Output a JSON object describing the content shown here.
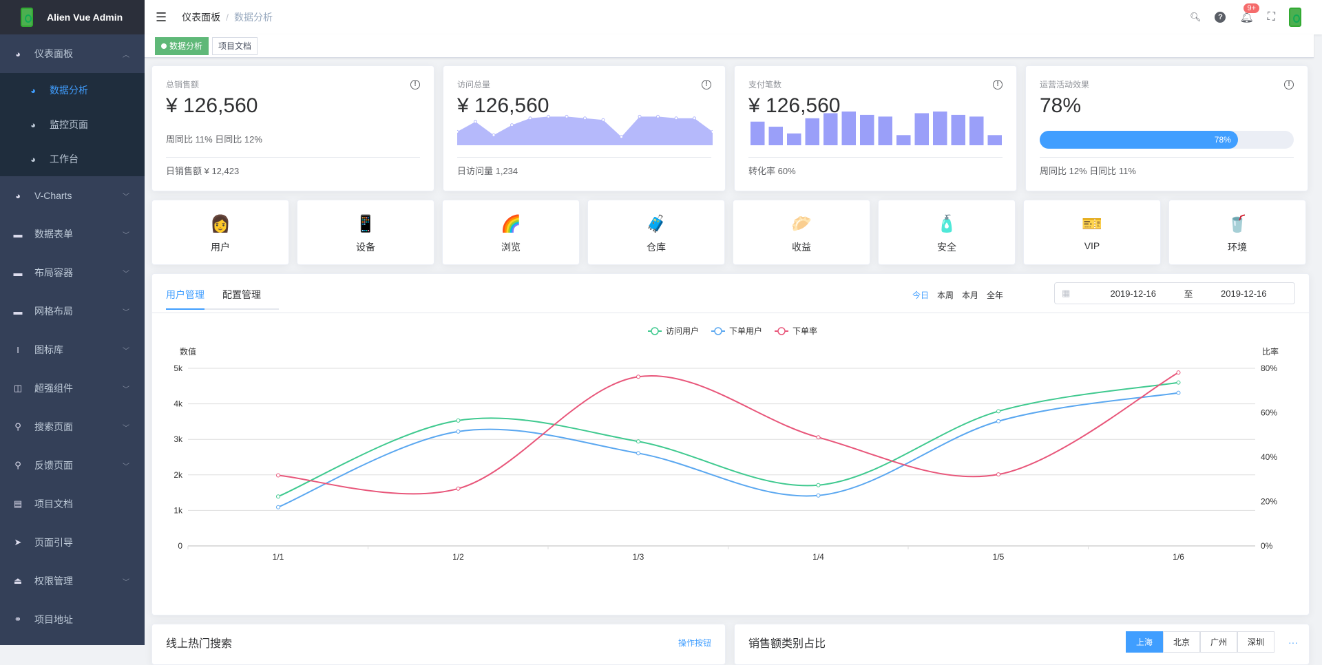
{
  "app": {
    "title": "Alien Vue Admin"
  },
  "sidebar": {
    "items": [
      {
        "label": "仪表面板",
        "icon": "dashboard-icon",
        "open": true,
        "children": [
          {
            "label": "数据分析",
            "active": true
          },
          {
            "label": "监控页面"
          },
          {
            "label": "工作台"
          }
        ]
      },
      {
        "label": "V-Charts",
        "icon": "dashboard-icon",
        "arrow": true
      },
      {
        "label": "数据表单",
        "icon": "folder-icon",
        "arrow": true
      },
      {
        "label": "布局容器",
        "icon": "folder-icon",
        "arrow": true
      },
      {
        "label": "网格布局",
        "icon": "folder-icon",
        "arrow": true
      },
      {
        "label": "图标库",
        "icon": "font-icon",
        "arrow": true
      },
      {
        "label": "超强组件",
        "icon": "chart-icon",
        "arrow": true
      },
      {
        "label": "搜索页面",
        "icon": "search-icon",
        "arrow": true
      },
      {
        "label": "反馈页面",
        "icon": "search-icon",
        "arrow": true
      },
      {
        "label": "项目文档",
        "icon": "document-icon",
        "arrow": false
      },
      {
        "label": "页面引导",
        "icon": "send-icon",
        "arrow": false
      },
      {
        "label": "权限管理",
        "icon": "lock-icon",
        "arrow": true
      },
      {
        "label": "项目地址",
        "icon": "link-icon",
        "arrow": false
      }
    ]
  },
  "header": {
    "breadcrumb": [
      "仪表面板",
      "数据分析"
    ],
    "notification_count": "9+"
  },
  "tags": [
    "数据分析",
    "项目文档"
  ],
  "stats": [
    {
      "title": "总销售额",
      "value": "¥ 126,560",
      "mid": "周同比 11%  日同比 12%",
      "foot": "日销售额 ¥ 12,423"
    },
    {
      "title": "访问总量",
      "value": "¥ 126,560",
      "foot": "日访问量 1,234",
      "spark": [
        4,
        7,
        3,
        6,
        8,
        8.5,
        8.5,
        8,
        7.5,
        2.5,
        8.5,
        8.5,
        8,
        8,
        4
      ]
    },
    {
      "title": "支付笔数",
      "value": "¥ 126,560",
      "foot": "转化率 60%",
      "bars": [
        7,
        5.5,
        3.5,
        8,
        9.5,
        10,
        9,
        8.5,
        3,
        9.5,
        10,
        9,
        8.5,
        3
      ]
    },
    {
      "title": "运营活动效果",
      "value": "78%",
      "progress": 78,
      "progress_label": "78%",
      "foot": "周同比 12%  日同比 11%"
    }
  ],
  "shortcuts": [
    {
      "label": "用户",
      "emoji": "👩"
    },
    {
      "label": "设备",
      "emoji": "📱"
    },
    {
      "label": "浏览",
      "emoji": "🌈"
    },
    {
      "label": "仓库",
      "emoji": "🧳"
    },
    {
      "label": "收益",
      "emoji": "🥟"
    },
    {
      "label": "安全",
      "emoji": "🧴"
    },
    {
      "label": "VIP",
      "emoji": "🎫"
    },
    {
      "label": "环境",
      "emoji": "🥤"
    }
  ],
  "panel": {
    "tabs": [
      "用户管理",
      "配置管理"
    ],
    "ranges": [
      "今日",
      "本周",
      "本月",
      "全年"
    ],
    "date_start": "2019-12-16",
    "date_sep": "至",
    "date_end": "2019-12-16"
  },
  "chart_data": {
    "type": "line",
    "x": [
      "1/1",
      "1/2",
      "1/3",
      "1/4",
      "1/5",
      "1/6"
    ],
    "ylabel": "数值",
    "y2label": "比率",
    "yticks": [
      "0",
      "1k",
      "2k",
      "3k",
      "4k",
      "5k"
    ],
    "y2ticks": [
      "0%",
      "20%",
      "40%",
      "60%",
      "80%"
    ],
    "ylim": [
      0,
      5000
    ],
    "y2lim": [
      0,
      80
    ],
    "series": [
      {
        "name": "访问用户",
        "color": "#3fc98f",
        "axis": "left",
        "values": [
          1390,
          3530,
          2940,
          1710,
          3790,
          4600
        ]
      },
      {
        "name": "下单用户",
        "color": "#5aa7f0",
        "axis": "left",
        "values": [
          1090,
          3220,
          2610,
          1420,
          3510,
          4310
        ]
      },
      {
        "name": "下单率",
        "color": "#e8567a",
        "axis": "right",
        "values": [
          31.8,
          25.8,
          76.2,
          48.9,
          32.2,
          78.1
        ]
      }
    ]
  },
  "bottom": {
    "left_title": "线上热门搜索",
    "left_link": "操作按钮",
    "right_title": "销售额类别占比",
    "cities": [
      "上海",
      "北京",
      "广州",
      "深圳"
    ],
    "more": "···"
  }
}
